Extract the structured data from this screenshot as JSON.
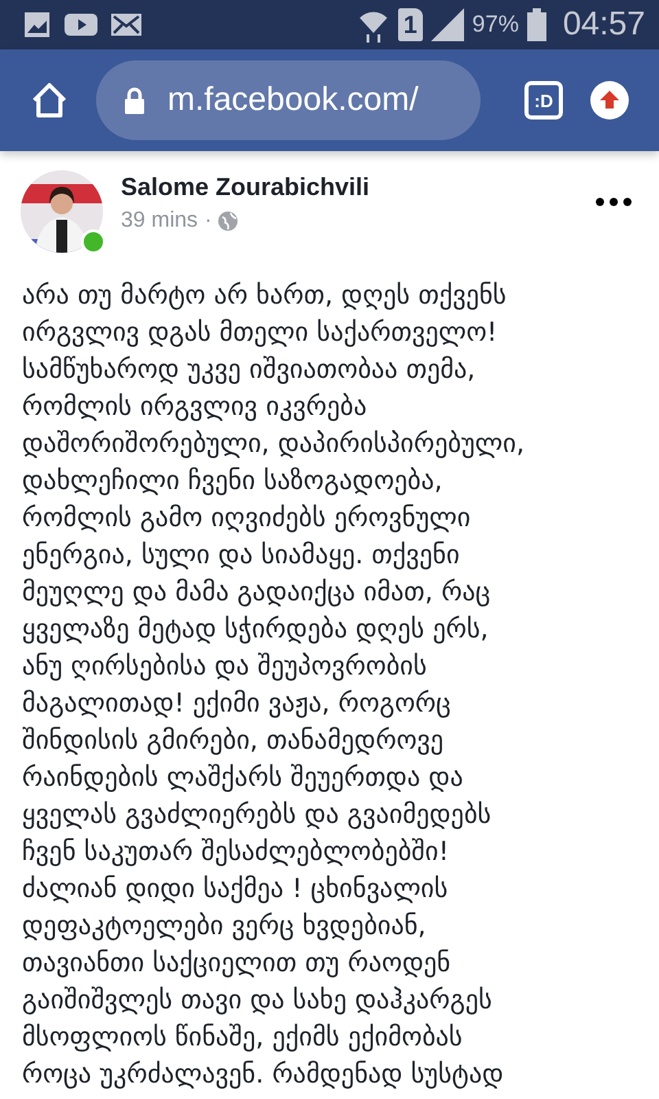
{
  "status_bar": {
    "battery": "97%",
    "time": "04:57",
    "sim": "1"
  },
  "browser": {
    "url": "m.facebook.com/",
    "tab_label": ":D"
  },
  "post": {
    "author": "Salome Zourabichvili",
    "online": true,
    "time": "39 mins",
    "separator": "·",
    "lines": [
      "არა თუ მარტო არ ხართ, დღეს თქვენს",
      "ირგვლივ დგას მთელი საქართველო!",
      "სამწუხაროდ უკვე იშვიათობაა თემა,",
      "რომლის ირგვლივ იკვრება",
      "დაშორიშორებული, დაპირისპირებული,",
      "დახლეჩილი ჩვენი საზოგადოება,",
      "რომლის გამო იღვიძებს ეროვნული",
      "ენერგია, სული და სიამაყე. თქვენი",
      "მეუღლე და მამა გადაიქცა იმათ, რაც",
      "ყველაზე მეტად სჭირდება დღეს ერს,",
      "ანუ ღირსებისა და შეუპოვრობის",
      "მაგალითად! ექიმი ვაჟა, როგორც",
      "შინდისის გმირები, თანამედროვე",
      "რაინდების ლაშქარს შეუერთდა და",
      "ყველას გვაძლიერებს და გვაიმედებს",
      "ჩვენ საკუთარ შესაძლებლობებში!",
      "ძალიან დიდი საქმეა ! ცხინვალის",
      "დეფაკტოელები ვერც ხვდებიან,",
      "თავიანთი საქციელით თუ რაოდენ",
      "გაიშიშვლეს თავი და სახე დაჰკარგეს",
      "მსოფლიოს წინაშე, ექიმს ექიმობას",
      "როცა უკრძალავენ. რამდენად სუსტად"
    ]
  }
}
